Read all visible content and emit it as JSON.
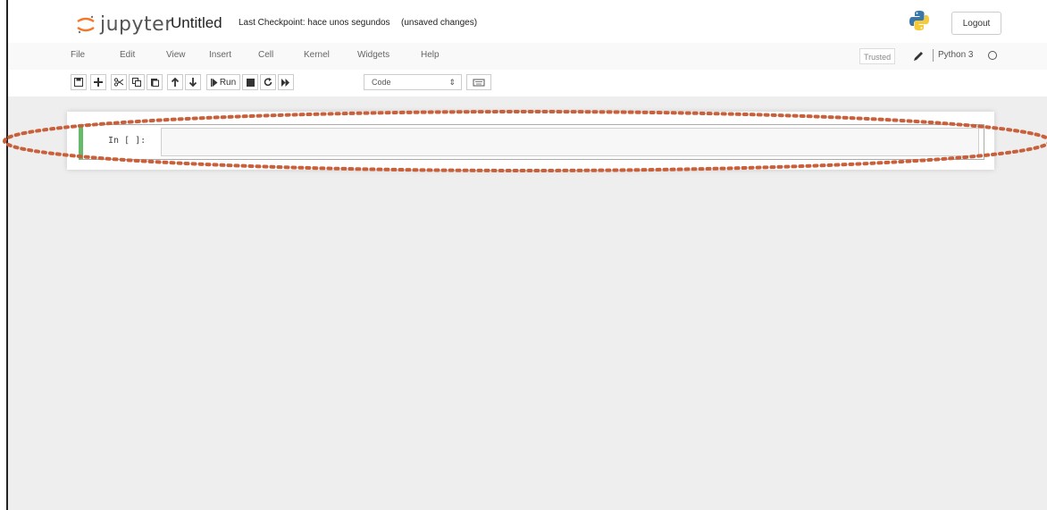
{
  "header": {
    "logo_text": "jupyter",
    "notebook_title": "Untitled",
    "checkpoint": "Last Checkpoint: hace unos segundos",
    "unsaved": "(unsaved changes)",
    "logout_label": "Logout"
  },
  "menubar": {
    "items": [
      "File",
      "Edit",
      "View",
      "Insert",
      "Cell",
      "Kernel",
      "Widgets",
      "Help"
    ],
    "trusted_label": "Trusted",
    "kernel_name": "Python 3"
  },
  "toolbar": {
    "run_label": "Run",
    "cell_type_value": "Code"
  },
  "cell": {
    "prompt": "In [ ]:",
    "content": ""
  },
  "colors": {
    "cell_selected_border": "#66bb6a",
    "annotation_dots": "#c8603c"
  },
  "icons": [
    "save-icon",
    "plus-icon",
    "scissors-icon",
    "copy-icon",
    "paste-icon",
    "arrow-up-icon",
    "arrow-down-icon",
    "stop-icon",
    "restart-icon",
    "fast-forward-icon",
    "keyboard-icon",
    "pencil-icon",
    "python-logo-icon"
  ]
}
